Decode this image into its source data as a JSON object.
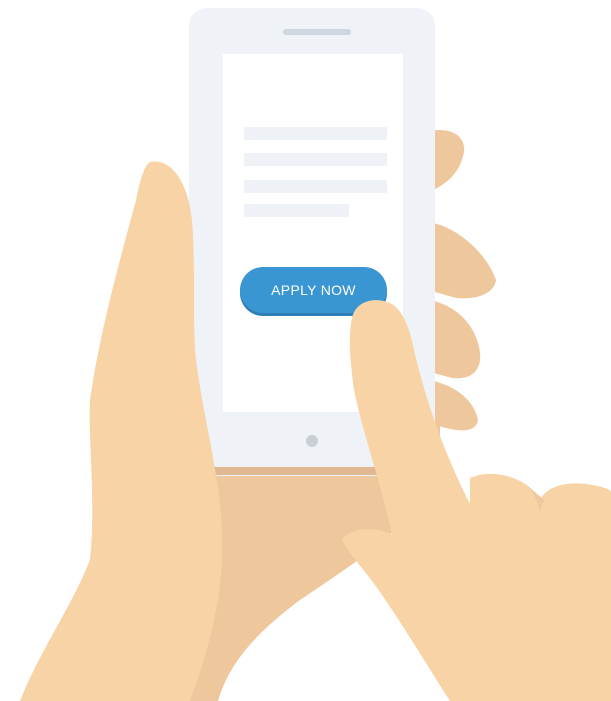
{
  "phone": {
    "button_label": "APPLY NOW",
    "placeholder_lines": 4
  },
  "colors": {
    "skin_light": "#F8D3A6",
    "skin_shadow": "#EEC89C",
    "skin_dark": "#E0B890",
    "phone_body": "#EFF3F7",
    "phone_screen": "#FFFFFF",
    "placeholder_line": "#EEF2F6",
    "speaker": "#CFD6DE",
    "home_button": "#CACFD6",
    "button": "#3A95D3",
    "button_shadow": "#2F7FB7",
    "button_text": "#FFFFFF"
  },
  "icons": {
    "home_button": "circle",
    "speaker": "rounded-bar"
  }
}
